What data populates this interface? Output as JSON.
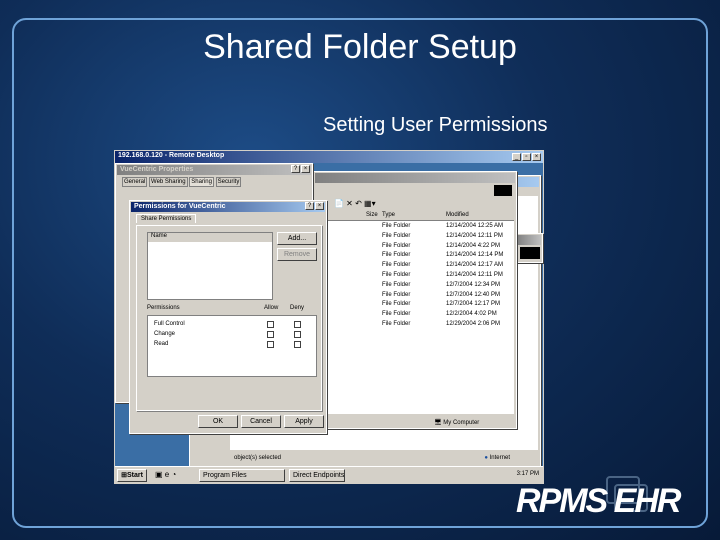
{
  "slide": {
    "title": "Shared Folder Setup",
    "subtitle": "Setting User Permissions",
    "logo": "RPMS EHR"
  },
  "remote": {
    "title": "192.168.0.120 - Remote Desktop"
  },
  "properties": {
    "title": "VueCentric Properties",
    "tabs": [
      "General",
      "Web Sharing",
      "Sharing",
      "Security"
    ]
  },
  "permissions": {
    "title": "Permissions for VueCentric",
    "tab": "Share Permissions",
    "name_header": "Name",
    "add": "Add...",
    "remove": "Remove",
    "perm_header": "Permissions",
    "allow": "Allow",
    "deny": "Deny",
    "rows": [
      {
        "label": "Full Control"
      },
      {
        "label": "Change"
      },
      {
        "label": "Read"
      }
    ],
    "ok": "OK",
    "cancel": "Cancel",
    "apply": "Apply"
  },
  "explorer": {
    "columns": [
      "Size",
      "Type",
      "Modified"
    ],
    "rows": [
      {
        "type": "File Folder",
        "modified": "12/14/2004 12:25 AM"
      },
      {
        "type": "File Folder",
        "modified": "12/14/2004 12:11 PM"
      },
      {
        "type": "File Folder",
        "modified": "12/14/2004 4:22 PM"
      },
      {
        "type": "File Folder",
        "modified": "12/14/2004 12:14 PM"
      },
      {
        "type": "File Folder",
        "modified": "12/14/2004 12:17 AM"
      },
      {
        "type": "File Folder",
        "modified": "12/14/2004 12:11 PM"
      },
      {
        "type": "File Folder",
        "modified": "12/7/2004 12:34 PM"
      },
      {
        "type": "File Folder",
        "modified": "12/7/2004 12:40 PM"
      },
      {
        "type": "File Folder",
        "modified": "12/7/2004 12:17 PM"
      },
      {
        "type": "File Folder",
        "modified": "12/2/2004 4:02 PM"
      },
      {
        "type": "File Folder",
        "modified": "12/29/2004 2:06 PM"
      }
    ],
    "status": "My Computer"
  },
  "browser": {
    "status_left": "object(s) selected",
    "status_zone": "Internet"
  },
  "taskbar": {
    "start": "Start",
    "items": [
      "Program Files",
      "Direct Endpoints"
    ],
    "clock": "3:17 PM"
  }
}
